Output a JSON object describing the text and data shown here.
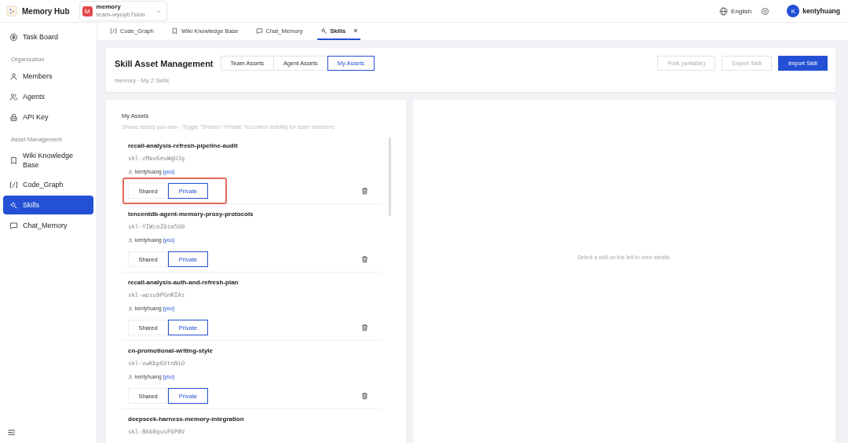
{
  "app": {
    "name": "Memory Hub"
  },
  "workspace": {
    "initial": "M",
    "name": "memory",
    "team": "team-wyuyb7sion"
  },
  "topbar": {
    "language": "English",
    "user_initial": "K",
    "user_name": "kentyhuang"
  },
  "sidebar": {
    "items": [
      {
        "kind": "item",
        "label": "Task Board",
        "selected": false
      },
      {
        "kind": "section",
        "label": "Organization"
      },
      {
        "kind": "item",
        "label": "Members",
        "selected": false
      },
      {
        "kind": "item",
        "label": "Agents",
        "selected": false
      },
      {
        "kind": "item",
        "label": "API Key",
        "selected": false
      },
      {
        "kind": "section",
        "label": "Asset Management"
      },
      {
        "kind": "item",
        "label": "Wiki Knowledge Base",
        "selected": false
      },
      {
        "kind": "item",
        "label": "Code_Graph",
        "selected": false
      },
      {
        "kind": "item",
        "label": "Skills",
        "selected": true
      },
      {
        "kind": "item",
        "label": "Chat_Memory",
        "selected": false
      }
    ]
  },
  "tabs": [
    {
      "label": "Code_Graph",
      "selected": false
    },
    {
      "label": "Wiki Knowledge Base",
      "selected": false
    },
    {
      "label": "Chat_Memory",
      "selected": false
    },
    {
      "label": "Skills",
      "selected": true,
      "close": "×"
    }
  ],
  "header": {
    "title": "Skill Asset Management",
    "segments": [
      {
        "label": "Team Assets",
        "selected": false
      },
      {
        "label": "Agent Assets",
        "selected": false
      },
      {
        "label": "My Assets",
        "selected": true
      }
    ],
    "subtitle": "memory · My 2 Skills",
    "buttons": [
      {
        "label": "Fork (writable)",
        "disabled": true,
        "primary": false
      },
      {
        "label": "Export Skill",
        "disabled": true,
        "primary": false
      },
      {
        "label": "Import Skill",
        "disabled": false,
        "primary": true
      }
    ]
  },
  "list": {
    "title": "My Assets",
    "description": "Shows assets you own · Toggle \"Shared / Private\" to control visibility for team members",
    "skills": [
      {
        "name": "recall-analysis-refresh-pipeline-audit",
        "id": "skl-zMav6euWgUJg",
        "owner": "kentyhuang",
        "owner_tag": "(you)",
        "highlighted": true,
        "options": [
          {
            "label": "Shared",
            "selected": false
          },
          {
            "label": "Private",
            "selected": true
          }
        ]
      },
      {
        "name": "tencentdb-agent-memory-proxy-protocols",
        "id": "skl-YIWcnZ0im5U0",
        "owner": "kentyhuang",
        "owner_tag": "(you)",
        "highlighted": false,
        "options": [
          {
            "label": "Shared",
            "selected": false
          },
          {
            "label": "Private",
            "selected": true
          }
        ]
      },
      {
        "name": "recall-analysis-auth-and-refresh-plan",
        "id": "skl-wpsu9PGnRIAz",
        "owner": "kentyhuang",
        "owner_tag": "(you)",
        "highlighted": false,
        "options": [
          {
            "label": "Shared",
            "selected": false
          },
          {
            "label": "Private",
            "selected": true
          }
        ]
      },
      {
        "name": "cn-promotional-writing-style",
        "id": "skl-vwKbp6VtnNiO",
        "owner": "kentyhuang",
        "owner_tag": "(you)",
        "highlighted": false,
        "options": [
          {
            "label": "Shared",
            "selected": false
          },
          {
            "label": "Private",
            "selected": true
          }
        ]
      },
      {
        "name": "deepseek-harness-memory-integration",
        "id": "skl-8kb8qusF6P8V"
      }
    ]
  },
  "detail": {
    "empty_text": "Select a skill on the left to view details."
  }
}
